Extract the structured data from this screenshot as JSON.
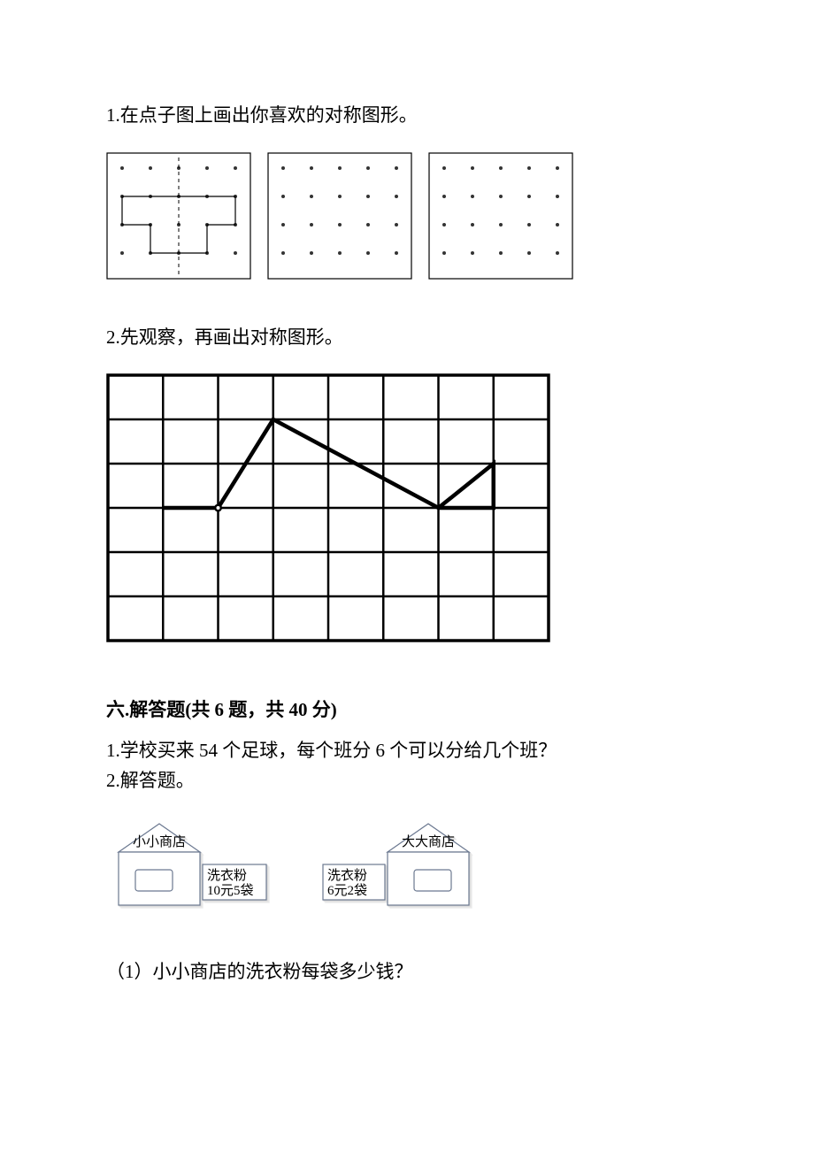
{
  "q1": {
    "text": "1.在点子图上画出你喜欢的对称图形。"
  },
  "q2": {
    "text": "2.先观察，再画出对称图形。"
  },
  "section6": {
    "header": "六.解答题(共 6 题，共 40 分)"
  },
  "s6q1": {
    "text": "1.学校买来 54 个足球，每个班分 6 个可以分给几个班？"
  },
  "s6q2": {
    "text": "2.解答题。"
  },
  "store1": {
    "name": "小小商店",
    "item_line1": "洗衣粉",
    "item_line2": "10元5袋"
  },
  "store2": {
    "name": "大大商店",
    "item_line1": "洗衣粉",
    "item_line2": "6元2袋"
  },
  "sub1": {
    "text": "（1）小小商店的洗衣粉每袋多少钱？"
  }
}
